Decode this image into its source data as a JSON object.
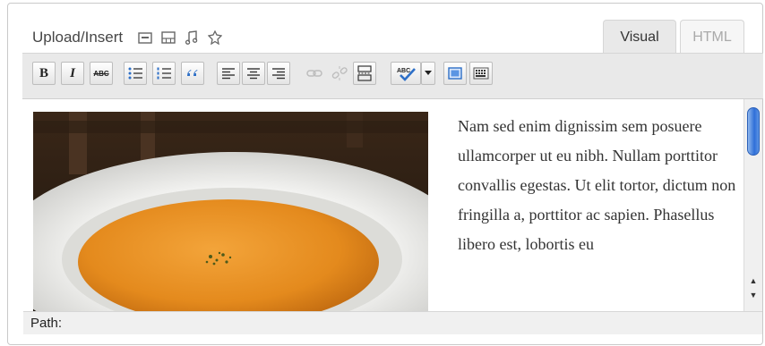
{
  "upload": {
    "label": "Upload/Insert",
    "icons": [
      "image-icon",
      "video-icon",
      "audio-icon",
      "media-icon"
    ]
  },
  "tabs": {
    "visual": "Visual",
    "html": "HTML",
    "active": "Visual"
  },
  "toolbar": {
    "bold": "B",
    "italic": "I",
    "strike": "ABC",
    "buttons": [
      "bold",
      "italic",
      "strikethrough",
      "bullet-list",
      "numbered-list",
      "blockquote",
      "align-left",
      "align-center",
      "align-right",
      "link",
      "unlink",
      "more-tag",
      "spellcheck",
      "spellcheck-dropdown",
      "fullscreen",
      "kitchen-sink"
    ]
  },
  "editor": {
    "text": "Nam sed enim dignissim sem posuere ullamcorper ut eu nibh. Nullam porttitor convallis egestas. Ut elit tortor, dictum non fringilla a, porttitor ac sapien. Phasellus libero est, lobortis eu",
    "image": "soup-bowl-photo"
  },
  "status": {
    "path_label": "Path:"
  },
  "colors": {
    "toolbar_bg": "#e9e9e9",
    "scroll_thumb": "#2f6fd8"
  }
}
